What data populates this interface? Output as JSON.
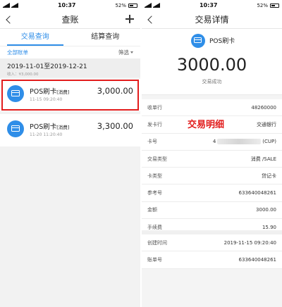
{
  "left": {
    "status": {
      "time": "10:37",
      "battery": "52%"
    },
    "nav": {
      "title": "查账"
    },
    "tabs": [
      {
        "label": "交易查询",
        "active": true
      },
      {
        "label": "结算查询",
        "active": false
      }
    ],
    "filter": {
      "all_bills": "全部账单",
      "filter_label": "筛选"
    },
    "date_range": "2019-11-01至2019-12-21",
    "income": "收入：¥3,000.00",
    "transactions": [
      {
        "title": "POS刷卡",
        "tag": "[消费]",
        "time": "11-15 09:20:40",
        "amount": "3,000.00"
      },
      {
        "title": "POS刷卡",
        "tag": "[消费]",
        "time": "11-20 11:20:40",
        "amount": "3,300.00"
      }
    ]
  },
  "right": {
    "status": {
      "time": "10:37",
      "battery": "52%"
    },
    "nav": {
      "title": "交易详情"
    },
    "summary": {
      "label": "POS刷卡",
      "amount": "3000.00",
      "status": "交易成功"
    },
    "overlay_text": "交易明细",
    "details": [
      {
        "label": "收单行",
        "value": "48260000"
      },
      {
        "label": "发卡行",
        "value": "交通银行"
      },
      {
        "label": "卡号",
        "value_prefix": "4",
        "value_suffix": "(CUP)"
      },
      {
        "label": "交易类型",
        "value": "消费 /SALE"
      },
      {
        "label": "卡类型",
        "value": "贷记卡"
      },
      {
        "label": "参考号",
        "value": "633640048261"
      },
      {
        "label": "金额",
        "value": "3000.00"
      },
      {
        "label": "手续费",
        "value": "15.90"
      }
    ],
    "details2": [
      {
        "label": "创建时间",
        "value": "2019-11-15 09:20:40"
      },
      {
        "label": "账单号",
        "value": "633640048261"
      }
    ]
  },
  "colors": {
    "accent": "#2f8ee8",
    "highlight": "#e21c1c"
  }
}
